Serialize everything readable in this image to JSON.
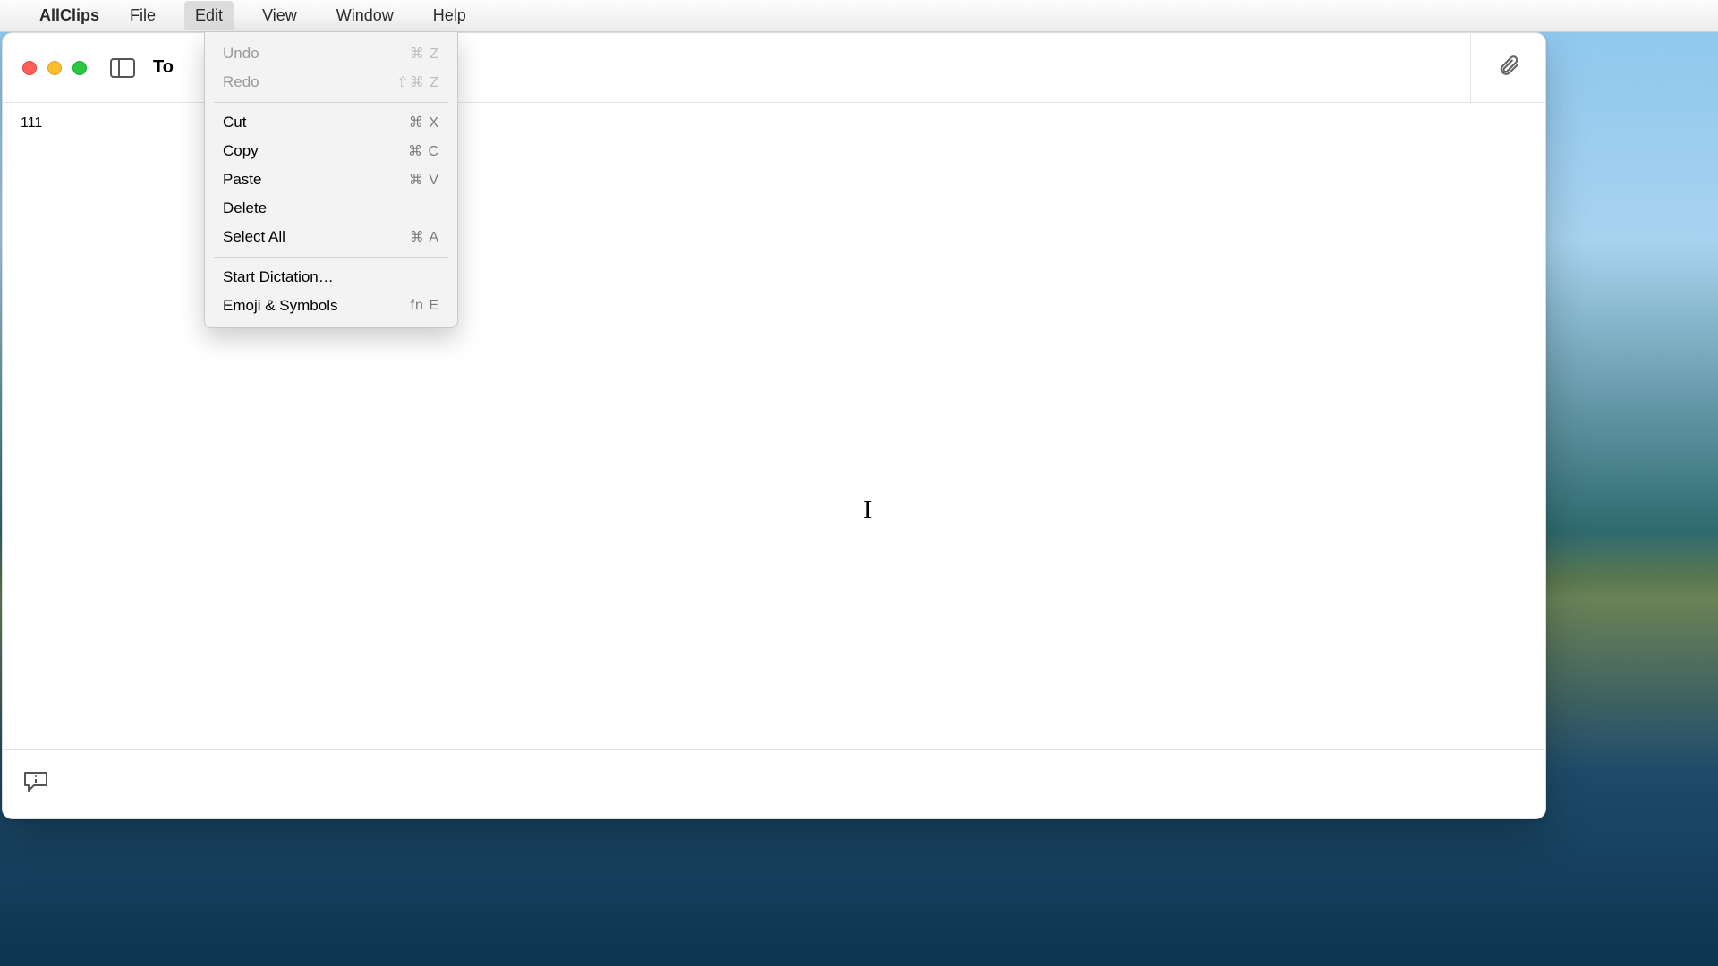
{
  "menubar": {
    "app_name": "AllClips",
    "items": [
      {
        "label": "File",
        "active": false
      },
      {
        "label": "Edit",
        "active": true
      },
      {
        "label": "View",
        "active": false
      },
      {
        "label": "Window",
        "active": false
      },
      {
        "label": "Help",
        "active": false
      }
    ]
  },
  "edit_menu": {
    "groups": [
      [
        {
          "label": "Undo",
          "shortcut": "⌘ Z",
          "disabled": true
        },
        {
          "label": "Redo",
          "shortcut": "⇧⌘ Z",
          "disabled": true
        }
      ],
      [
        {
          "label": "Cut",
          "shortcut": "⌘ X",
          "disabled": false
        },
        {
          "label": "Copy",
          "shortcut": "⌘ C",
          "disabled": false
        },
        {
          "label": "Paste",
          "shortcut": "⌘ V",
          "disabled": false
        },
        {
          "label": "Delete",
          "shortcut": "",
          "disabled": false
        },
        {
          "label": "Select All",
          "shortcut": "⌘ A",
          "disabled": false
        }
      ],
      [
        {
          "label": "Start Dictation…",
          "shortcut": "",
          "disabled": false
        },
        {
          "label": "Emoji & Symbols",
          "shortcut": "fn E",
          "disabled": false
        }
      ]
    ]
  },
  "window": {
    "title_prefix": "To",
    "note_text": "111"
  },
  "icons": {
    "apple": "apple-icon",
    "sidebar": "sidebar-toggle-icon",
    "attachment": "paperclip-icon",
    "info": "info-bubble-icon"
  }
}
